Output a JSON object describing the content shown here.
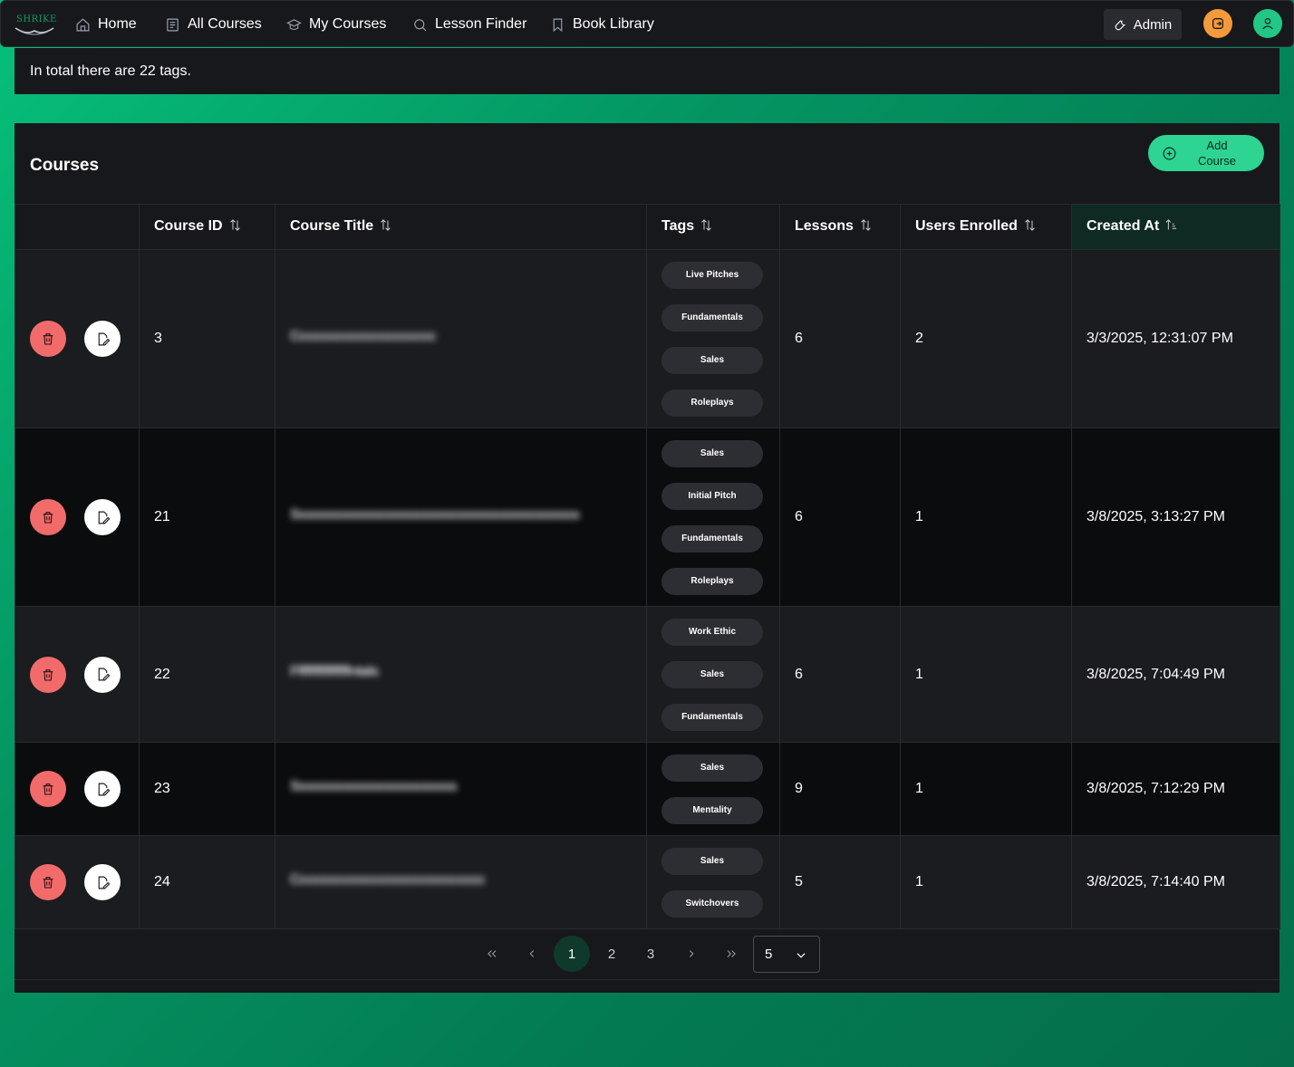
{
  "nav": {
    "logo_text": "SHRIKE",
    "items": [
      {
        "label": "Home",
        "icon": "home-icon"
      },
      {
        "label": "All Courses",
        "icon": "book-icon"
      },
      {
        "label": "My Courses",
        "icon": "graduation-cap-icon"
      },
      {
        "label": "Lesson Finder",
        "icon": "search-icon"
      },
      {
        "label": "Book Library",
        "icon": "bookmark-icon"
      }
    ],
    "admin_label": "Admin"
  },
  "summary": {
    "text": "In total there are 22 tags."
  },
  "courses": {
    "title": "Courses",
    "add_button_label": "Add Course",
    "columns": [
      {
        "label": ""
      },
      {
        "label": "Course ID"
      },
      {
        "label": "Course Title"
      },
      {
        "label": "Tags"
      },
      {
        "label": "Lessons"
      },
      {
        "label": "Users Enrolled"
      },
      {
        "label": "Created At"
      }
    ],
    "rows": [
      {
        "id": "3",
        "title": "Cccccccccccccccccccc",
        "tags": [
          "Live Pitches",
          "Fundamentals",
          "Sales",
          "Roleplays"
        ],
        "lessons": "6",
        "users": "2",
        "created": "3/3/2025, 12:31:07 PM"
      },
      {
        "id": "21",
        "title": "Sssssssssssssssssssssssssssssssssssssssssde",
        "tags": [
          "Sales",
          "Initial Pitch",
          "Fundamentals",
          "Roleplays"
        ],
        "lessons": "6",
        "users": "1",
        "created": "3/8/2025, 3:13:27 PM"
      },
      {
        "id": "22",
        "title": "Ffffffffffffffntals",
        "tags": [
          "Work Ethic",
          "Sales",
          "Fundamentals"
        ],
        "lessons": "6",
        "users": "1",
        "created": "3/8/2025, 7:04:49 PM"
      },
      {
        "id": "23",
        "title": "Ssssssssssssssssssssssssach",
        "tags": [
          "Sales",
          "Mentality"
        ],
        "lessons": "9",
        "users": "1",
        "created": "3/8/2025, 7:12:29 PM"
      },
      {
        "id": "24",
        "title": "Ccccccccccccccccccccccccccccccood",
        "tags": [
          "Sales",
          "Switchovers"
        ],
        "lessons": "5",
        "users": "1",
        "created": "3/8/2025, 7:14:40 PM"
      }
    ]
  },
  "pagination": {
    "pages": [
      "1",
      "2",
      "3"
    ],
    "current_page": "1",
    "rows_per_page": "5"
  },
  "colors": {
    "accent": "#2dd492",
    "delete": "#f26b6b",
    "logout": "#f59a3b",
    "background_gradient": "#06c07a"
  }
}
